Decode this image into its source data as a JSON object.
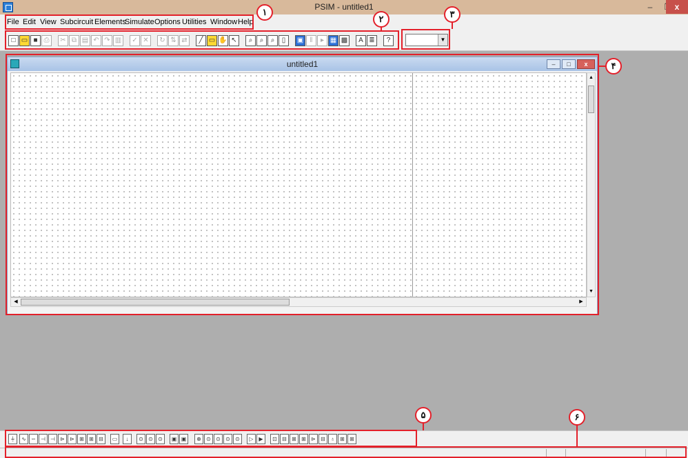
{
  "app_title": "PSIM - untitled1",
  "menu": [
    "File",
    "Edit",
    "View",
    "Subcircuit",
    "Elements",
    "Simulate",
    "Options",
    "Utilities",
    "Window",
    "Help"
  ],
  "window_controls": {
    "minimize": "–",
    "restore": "❐",
    "close": "x"
  },
  "child_window": {
    "title": "untitled1"
  },
  "annotations": [
    "۱",
    "۲",
    "۳",
    "۴",
    "۵",
    "۶"
  ],
  "colors": {
    "annotation": "#e3202a",
    "titlebar": "#d8b99b",
    "close": "#c7504a"
  }
}
